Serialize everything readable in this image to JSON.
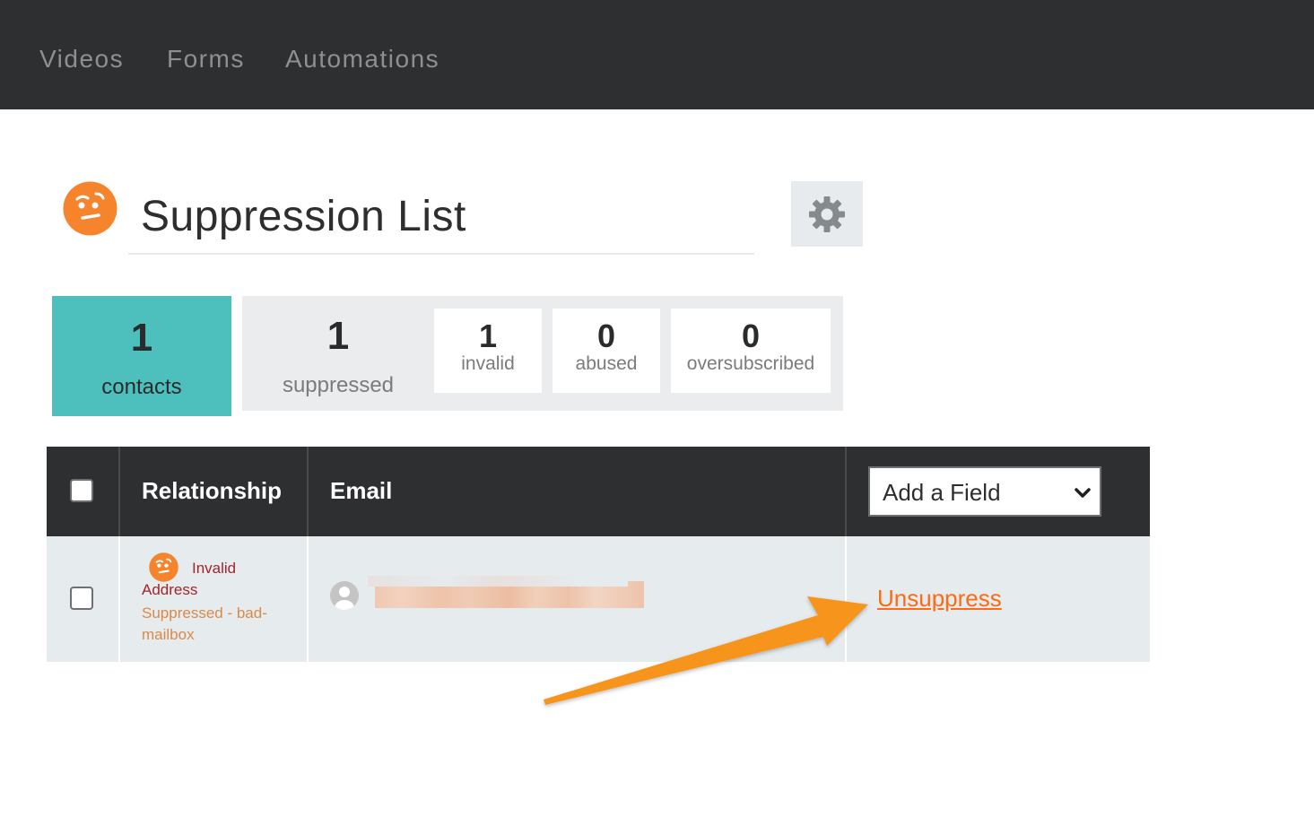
{
  "nav": {
    "items": [
      {
        "label": "Videos"
      },
      {
        "label": "Forms"
      },
      {
        "label": "Automations"
      }
    ]
  },
  "header": {
    "title": "Suppression List",
    "list_icon": "skeptical-face-icon",
    "settings_icon": "gear-icon"
  },
  "stats": {
    "contacts": {
      "value": "1",
      "label": "contacts"
    },
    "suppressed": {
      "value": "1",
      "label": "suppressed"
    },
    "invalid": {
      "value": "1",
      "label": "invalid"
    },
    "abused": {
      "value": "0",
      "label": "abused"
    },
    "oversubscribed": {
      "value": "0",
      "label": "oversubscribed"
    }
  },
  "table": {
    "columns": [
      "Relationship",
      "Email"
    ],
    "add_field": {
      "label": "Add a Field"
    },
    "rows": [
      {
        "relationship_status": "Invalid Address",
        "relationship_status_first": "Invalid",
        "relationship_status_second": "Address",
        "relationship_detail": "Suppressed - bad-mailbox",
        "email": "[redacted]",
        "action": "Unsuppress"
      }
    ]
  },
  "colors": {
    "topbar": "#2e2f31",
    "accent_teal": "#4dc0bd",
    "accent_orange": "#ff6a13",
    "annotation_arrow": "#f7941d",
    "status_red": "#a3252c",
    "status_orange": "#d98a4a"
  }
}
